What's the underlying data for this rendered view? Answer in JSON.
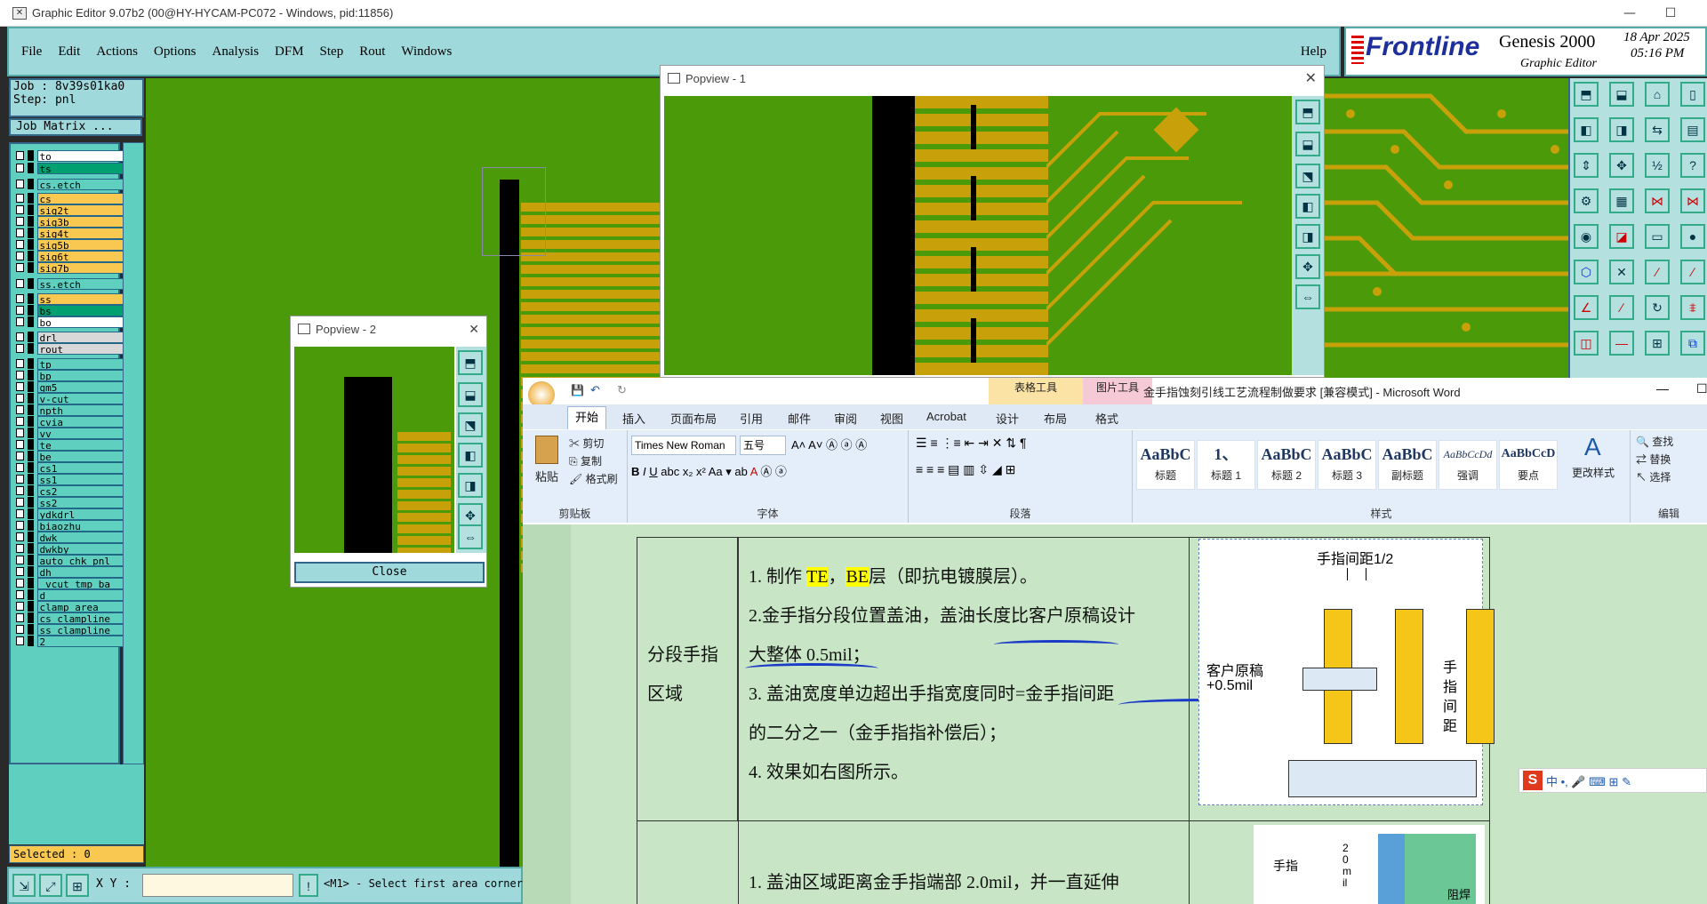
{
  "titlebar": {
    "text": "Graphic Editor 9.07b2 (00@HY-HYCAM-PC072 - Windows, pid:11856)"
  },
  "menu": [
    "File",
    "Edit",
    "Actions",
    "Options",
    "Analysis",
    "DFM",
    "Step",
    "Rout",
    "Windows"
  ],
  "help": "Help",
  "brand": {
    "logo": "Frontline",
    "product": "Genesis 2000",
    "sub": "Graphic Editor",
    "date": "18 Apr 2025",
    "time": "05:16 PM"
  },
  "job": {
    "job": "Job : 8v39s01ka0",
    "step": "Step: pnl",
    "matrix_btn": "Job Matrix ..."
  },
  "layers": [
    {
      "name": "to",
      "color": "#ffffff"
    },
    {
      "name": "ts",
      "color": "#00a070"
    },
    {
      "name": "cs.etch",
      "color": "#5fcfbf"
    },
    {
      "name": "cs",
      "color": "#f8c850"
    },
    {
      "name": "sig2t",
      "color": "#f8c850"
    },
    {
      "name": "sig3b",
      "color": "#f8c850"
    },
    {
      "name": "sig4t",
      "color": "#f8c850"
    },
    {
      "name": "sig5b",
      "color": "#f8c850"
    },
    {
      "name": "sig6t",
      "color": "#f8c850"
    },
    {
      "name": "sig7b",
      "color": "#f8c850"
    },
    {
      "name": "ss.etch",
      "color": "#5fcfbf"
    },
    {
      "name": "ss",
      "color": "#f8c850"
    },
    {
      "name": "bs",
      "color": "#00a070"
    },
    {
      "name": "bo",
      "color": "#ffffff"
    },
    {
      "name": "drl",
      "color": "#d8d8d8"
    },
    {
      "name": "rout",
      "color": "#d8d8d8"
    },
    {
      "name": "tp",
      "color": "#5fcfbf"
    },
    {
      "name": "bp",
      "color": "#5fcfbf"
    },
    {
      "name": "gm5",
      "color": "#5fcfbf"
    },
    {
      "name": "v-cut",
      "color": "#5fcfbf"
    },
    {
      "name": "npth",
      "color": "#5fcfbf"
    },
    {
      "name": "cvia",
      "color": "#5fcfbf"
    },
    {
      "name": "vv",
      "color": "#5fcfbf"
    },
    {
      "name": "te",
      "color": "#5fcfbf"
    },
    {
      "name": "be",
      "color": "#5fcfbf"
    },
    {
      "name": "cs1",
      "color": "#5fcfbf"
    },
    {
      "name": "ss1",
      "color": "#5fcfbf"
    },
    {
      "name": "cs2",
      "color": "#5fcfbf"
    },
    {
      "name": "ss2",
      "color": "#5fcfbf"
    },
    {
      "name": "ydkdrl",
      "color": "#5fcfbf"
    },
    {
      "name": "biaozhu",
      "color": "#5fcfbf"
    },
    {
      "name": "dwk",
      "color": "#5fcfbf"
    },
    {
      "name": "dwkby",
      "color": "#5fcfbf"
    },
    {
      "name": "auto_chk_pnl",
      "color": "#5fcfbf"
    },
    {
      "name": "dh",
      "color": "#5fcfbf"
    },
    {
      "name": "_vcut_tmp_ba",
      "color": "#5fcfbf"
    },
    {
      "name": "d",
      "color": "#5fcfbf"
    },
    {
      "name": "clamp_area",
      "color": "#5fcfbf"
    },
    {
      "name": "cs_clampline",
      "color": "#5fcfbf"
    },
    {
      "name": "ss_clampline",
      "color": "#5fcfbf"
    },
    {
      "name": "2",
      "color": "#5fcfbf"
    }
  ],
  "status": {
    "selected": "Selected : 0",
    "xy_label": "X Y :",
    "prompt": "<M1> - Select first area corner"
  },
  "popview1": {
    "title": "Popview - 1"
  },
  "popview2": {
    "title": "Popview - 2",
    "close": "Close"
  },
  "word": {
    "title": "金手指蚀刻引线工艺流程制做要求 [兼容模式] - Microsoft Word",
    "context_tabs": [
      "表格工具",
      "图片工具"
    ],
    "tabs": [
      "开始",
      "插入",
      "页面布局",
      "引用",
      "邮件",
      "审阅",
      "视图",
      "Acrobat",
      "设计",
      "布局",
      "格式"
    ],
    "clipboard": {
      "paste": "粘贴",
      "cut": "剪切",
      "copy": "复制",
      "painter": "格式刷",
      "label": "剪贴板"
    },
    "font": {
      "name": "Times New Roman",
      "size": "五号",
      "label": "字体"
    },
    "para_label": "段落",
    "styles": [
      {
        "pv": "AaBbC",
        "lb": "标题"
      },
      {
        "pv": "1、",
        "lb": "标题 1"
      },
      {
        "pv": "AaBbC",
        "lb": "标题 2"
      },
      {
        "pv": "AaBbC",
        "lb": "标题 3"
      },
      {
        "pv": "AaBbC",
        "lb": "副标题"
      },
      {
        "pv": "AaBbCcDd",
        "lb": "强调"
      },
      {
        "pv": "AaBbCcD",
        "lb": "要点"
      }
    ],
    "styles_label": "样式",
    "change_style": "更改样式",
    "edit": {
      "find": "查找",
      "replace": "替换",
      "select": "选择",
      "label": "编辑"
    }
  },
  "doc": {
    "cell_title": [
      "分段手指",
      "区域"
    ],
    "line1a": "1. 制作 ",
    "te": "TE",
    "comma": "，",
    "be": "BE",
    "line1b": "层（即抗电镀膜层）。",
    "line2": "2.金手指分段位置盖油，盖油长度比客户原稿设计",
    "line3": "大整体 0.5mil；",
    "line4": "3. 盖油宽度单边超出手指宽度同时=金手指间距",
    "line5": "的二分之一（金手指指补偿后）；",
    "line6": "4.  效果如右图所示。",
    "next_line": "1.  盖油区域距离金手指端部  2.0mil，并一直延伸",
    "fig": {
      "top": "手指间距1/2",
      "left1": "客户原稿",
      "left2": "+0.5mil",
      "right": "手指间距"
    },
    "fig2": {
      "label1": "手指",
      "label2": "20mil",
      "label3": "阻焊"
    }
  }
}
